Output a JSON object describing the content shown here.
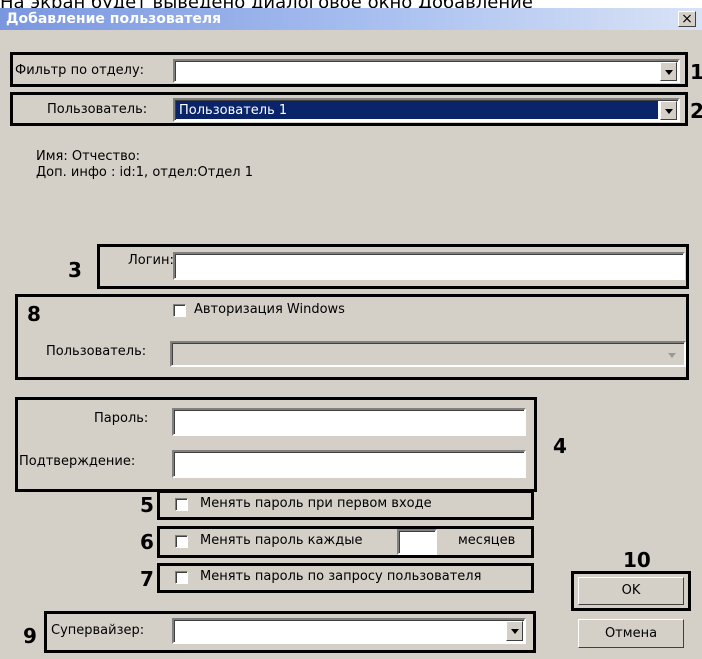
{
  "caption": "На экран будет выведено диалоговое окно Добавление",
  "dialog": {
    "title": "Добавление пользователя",
    "close_glyph": "×",
    "department_filter": {
      "label": "Фильтр по отделу:",
      "value": ""
    },
    "user": {
      "label": "Пользователь:",
      "value": "Пользователь 1"
    },
    "info": {
      "name_line": "Имя: Отчество:",
      "extra_line": "Доп. инфо : id:1, отдел:Отдел 1"
    },
    "login": {
      "label": "Логин:",
      "value": ""
    },
    "windows_auth": {
      "checkbox_label": "Авторизация Windows",
      "checked": false,
      "user_label": "Пользователь:",
      "user_value": ""
    },
    "password": {
      "label": "Пароль:",
      "value": ""
    },
    "confirm": {
      "label": "Подтверждение:",
      "value": ""
    },
    "options": {
      "change_first_login": "Менять пароль при первом входе",
      "change_every": "Менять пароль каждые",
      "months_value": "",
      "months_label": "месяцев",
      "change_on_request": "Менять пароль по запросу пользователя"
    },
    "supervisor": {
      "label": "Супервайзер:",
      "value": ""
    },
    "ok_label": "OK",
    "cancel_label": "Отмена"
  },
  "annotations": {
    "n1": "1",
    "n2": "2",
    "n3": "3",
    "n4": "4",
    "n5": "5",
    "n6": "6",
    "n7": "7",
    "n8": "8",
    "n9": "9",
    "n10": "10"
  }
}
